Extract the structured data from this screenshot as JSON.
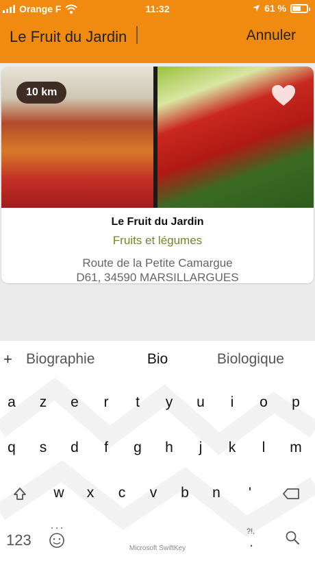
{
  "status_bar": {
    "carrier": "Orange F",
    "time": "11:32",
    "battery": "61 %",
    "battery_level": 0.61
  },
  "search": {
    "value": "Le Fruit du Jardin",
    "cancel_label": "Annuler"
  },
  "result": {
    "distance": "10 km",
    "name": "Le Fruit du Jardin",
    "category": "Fruits et légumes",
    "address_line1": "Route de la Petite Camargue",
    "address_line2": "D61, 34590 MARSILLARGUES"
  },
  "keyboard": {
    "suggest_plus": "+",
    "suggestions": [
      "Biographie",
      "Bio",
      "Biologique"
    ],
    "row1": [
      "a",
      "z",
      "e",
      "r",
      "t",
      "y",
      "u",
      "i",
      "o",
      "p"
    ],
    "row2": [
      "q",
      "s",
      "d",
      "f",
      "g",
      "h",
      "j",
      "k",
      "l",
      "m"
    ],
    "row3": [
      "w",
      "x",
      "c",
      "v",
      "b",
      "n",
      "'"
    ],
    "numbers_key": "123",
    "punct_key": "?!,",
    "punct_dot": ".",
    "brand": "Microsoft SwiftKey"
  }
}
